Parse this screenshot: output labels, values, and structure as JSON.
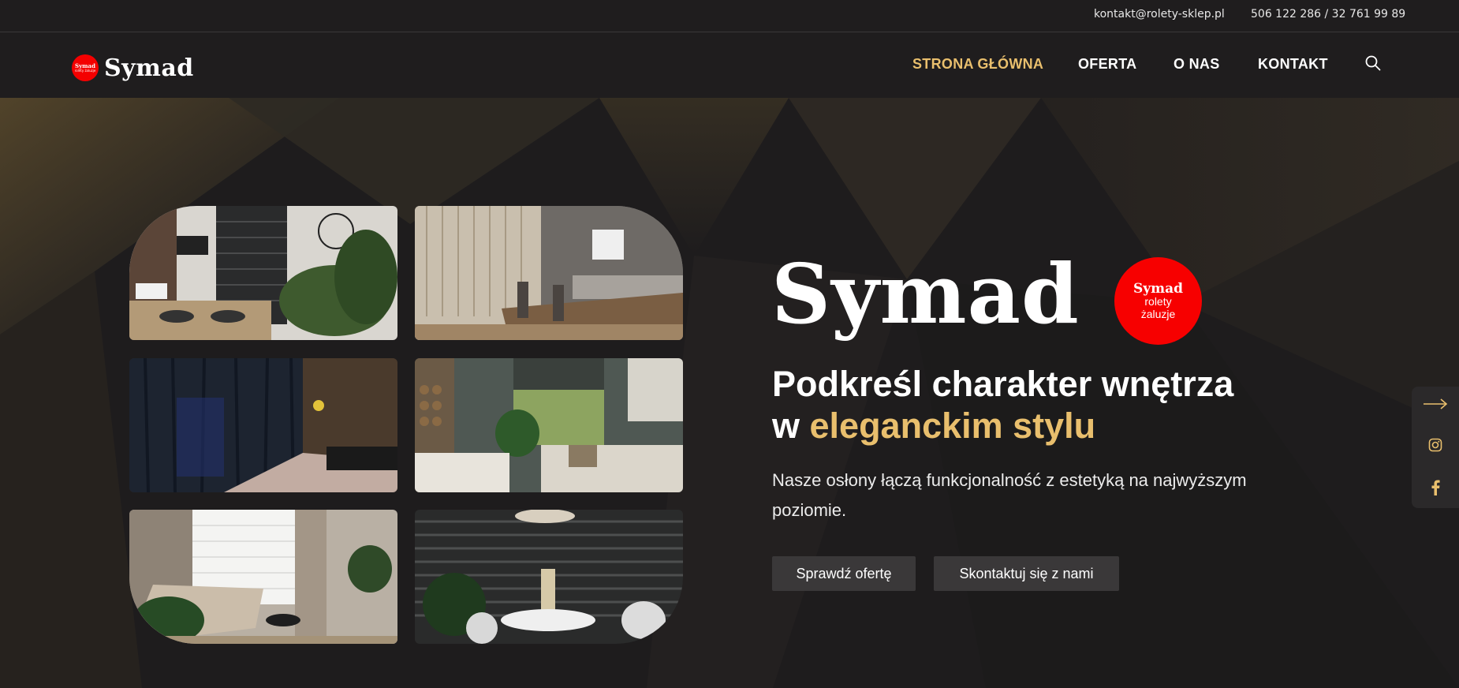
{
  "topbar": {
    "email": "kontakt@rolety-sklep.pl",
    "phone": "506 122 286 / 32 761 99 89"
  },
  "logo": {
    "badge_line1": "Symad",
    "badge_line2": "rolety żaluzje",
    "wordmark": "Symad"
  },
  "nav": {
    "items": [
      {
        "label": "STRONA GŁÓWNA",
        "active": true
      },
      {
        "label": "OFERTA",
        "active": false
      },
      {
        "label": "O NAS",
        "active": false
      },
      {
        "label": "KONTAKT",
        "active": false
      }
    ],
    "search_icon": "search-icon"
  },
  "hero": {
    "brand": "Symad",
    "badge": {
      "line1": "Symad",
      "line2": "rolety",
      "line3": "żaluzje"
    },
    "headline_line1": "Podkreśl charakter wnętrza",
    "headline_prefix": "w ",
    "headline_accent": "eleganckim stylu",
    "lead": "Nasze osłony łączą funkcjonalność z estetyką na najwyższym poziomie.",
    "btn_offer": "Sprawdź ofertę",
    "btn_contact": "Skontaktuj się z nami"
  },
  "gallery": [
    {
      "icon": "dining-room-blinds-photo"
    },
    {
      "icon": "office-vertical-blinds-photo"
    },
    {
      "icon": "bedroom-curtains-photo"
    },
    {
      "icon": "living-room-roman-blind-photo"
    },
    {
      "icon": "living-room-pleated-blinds-photo"
    },
    {
      "icon": "dining-room-venetian-blinds-photo"
    }
  ],
  "side": {
    "icons": [
      "arrow-right-icon",
      "instagram-icon",
      "facebook-icon"
    ]
  },
  "colors": {
    "background": "#1f1d1e",
    "accent": "#e9bf6d",
    "brand_red": "#f70000",
    "button": "#3a3839"
  }
}
